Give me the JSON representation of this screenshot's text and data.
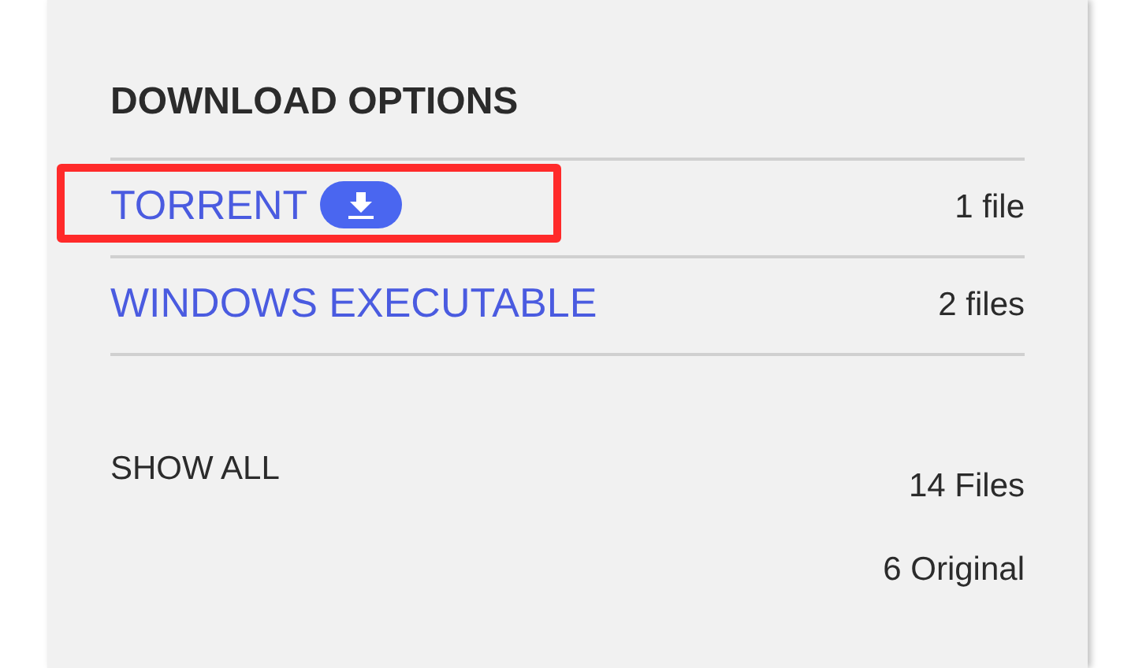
{
  "title": "DOWNLOAD OPTIONS",
  "options": [
    {
      "label": "TORRENT",
      "count": "1 file",
      "download_badge": true,
      "highlighted": true
    },
    {
      "label": "WINDOWS EXECUTABLE",
      "count": "2 files",
      "download_badge": false,
      "highlighted": false
    }
  ],
  "show_all": {
    "label": "SHOW ALL",
    "files": "14 Files",
    "original": "6 Original"
  }
}
